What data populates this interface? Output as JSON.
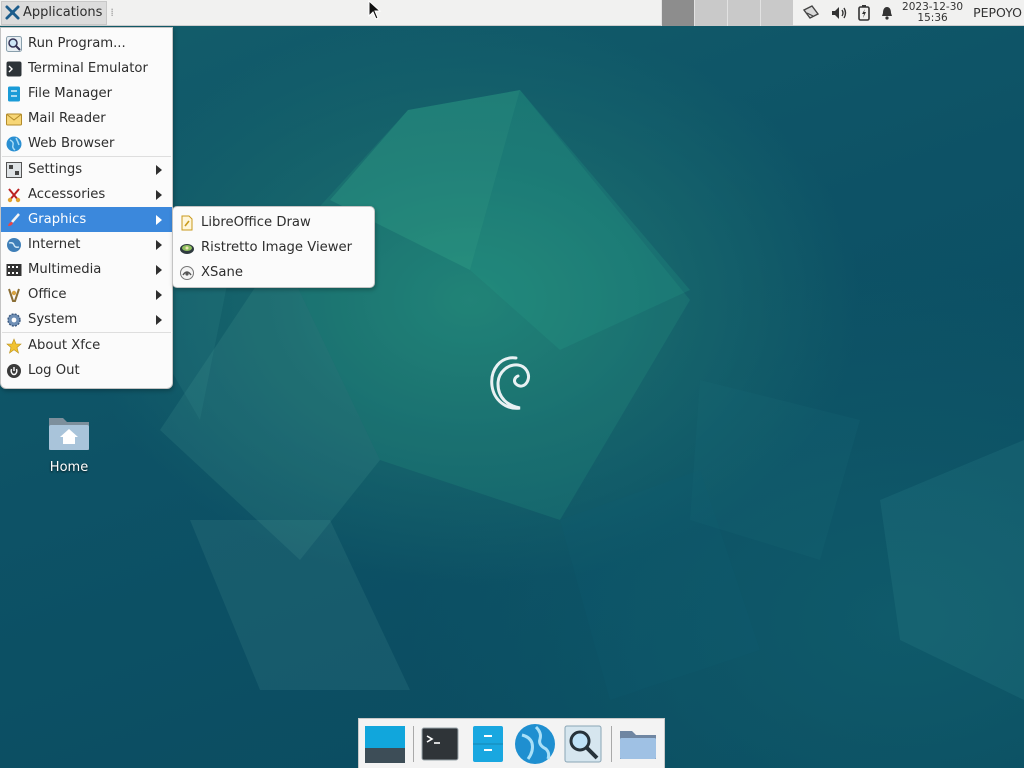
{
  "panel": {
    "apps_label": "Applications",
    "clock_date": "2023-12-30",
    "clock_time": "15:36",
    "username": "PEPOYO",
    "workspaces": 4,
    "active_workspace": 1
  },
  "menu": {
    "items": [
      {
        "label": "Run Program...",
        "icon": "search-icon"
      },
      {
        "label": "Terminal Emulator",
        "icon": "terminal-icon"
      },
      {
        "label": "File Manager",
        "icon": "file-manager-icon"
      },
      {
        "label": "Mail Reader",
        "icon": "mail-icon"
      },
      {
        "label": "Web Browser",
        "icon": "globe-icon"
      },
      {
        "label": "Settings",
        "icon": "settings-icon",
        "submenu": true
      },
      {
        "label": "Accessories",
        "icon": "accessories-icon",
        "submenu": true
      },
      {
        "label": "Graphics",
        "icon": "graphics-icon",
        "submenu": true,
        "selected": true
      },
      {
        "label": "Internet",
        "icon": "internet-icon",
        "submenu": true
      },
      {
        "label": "Multimedia",
        "icon": "multimedia-icon",
        "submenu": true
      },
      {
        "label": "Office",
        "icon": "office-icon",
        "submenu": true
      },
      {
        "label": "System",
        "icon": "system-icon",
        "submenu": true
      },
      {
        "label": "About Xfce",
        "icon": "star-icon"
      },
      {
        "label": "Log Out",
        "icon": "logout-icon"
      }
    ]
  },
  "submenu": {
    "items": [
      {
        "label": "LibreOffice Draw",
        "icon": "libreoffice-draw-icon"
      },
      {
        "label": "Ristretto Image Viewer",
        "icon": "image-viewer-icon"
      },
      {
        "label": "XSane",
        "icon": "scanner-icon"
      }
    ]
  },
  "desktop": {
    "icons": [
      {
        "label": "Home",
        "icon": "home-folder-icon"
      }
    ]
  },
  "dock": {
    "items": [
      "show-desktop-icon",
      "terminal-icon",
      "file-manager-icon",
      "web-browser-icon",
      "app-finder-icon",
      "folder-icon"
    ]
  },
  "colors": {
    "menu_highlight": "#3b88dc",
    "desktop_bg": "#0d4f62"
  }
}
